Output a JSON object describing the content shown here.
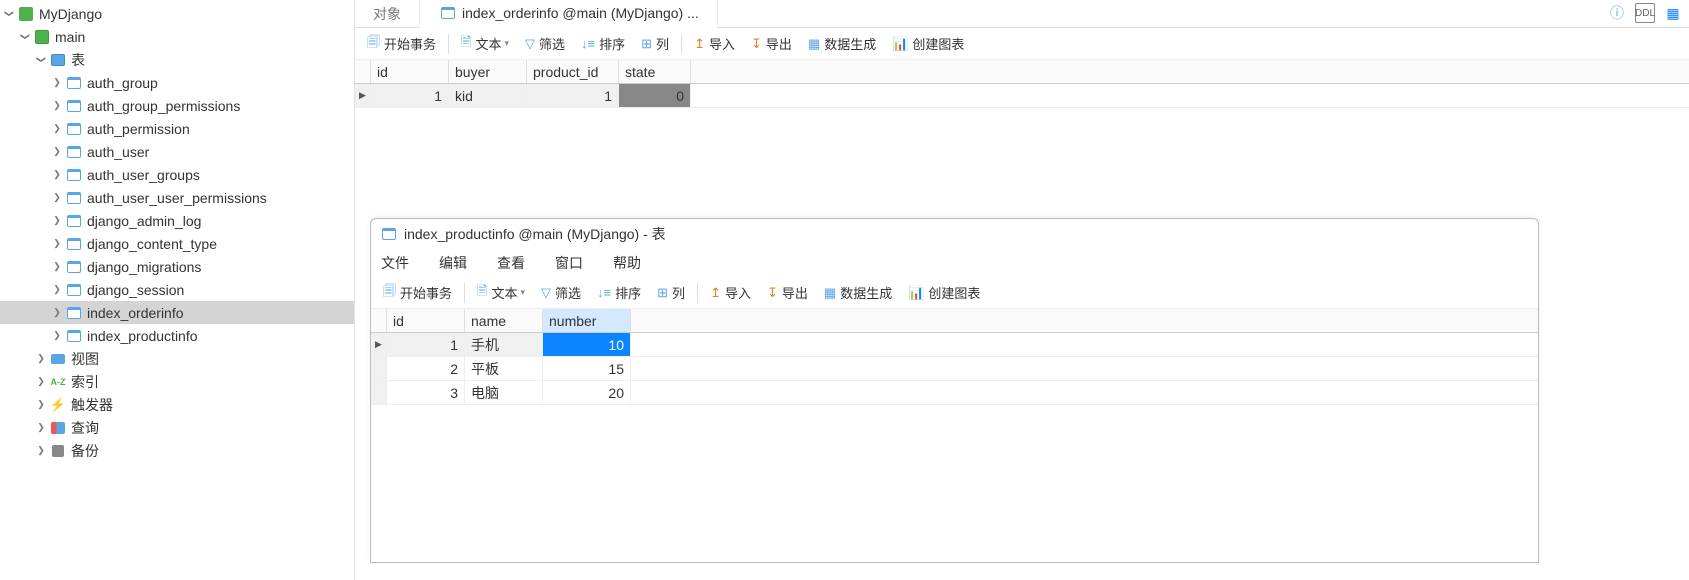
{
  "tree": {
    "root": "MyDjango",
    "schema": "main",
    "tables_label": "表",
    "tables": [
      "auth_group",
      "auth_group_permissions",
      "auth_permission",
      "auth_user",
      "auth_user_groups",
      "auth_user_user_permissions",
      "django_admin_log",
      "django_content_type",
      "django_migrations",
      "django_session",
      "index_orderinfo",
      "index_productinfo"
    ],
    "selected_table": "index_orderinfo",
    "views": "视图",
    "indexes": "索引",
    "triggers": "触发器",
    "queries": "查询",
    "backups": "备份"
  },
  "tabs": {
    "obj": "对象",
    "active": "index_orderinfo @main (MyDjango) ..."
  },
  "toolbar": {
    "begin_tx": "开始事务",
    "text": "文本",
    "filter": "筛选",
    "sort": "排序",
    "columns": "列",
    "import": "导入",
    "export": "导出",
    "datagen": "数据生成",
    "chart": "创建图表"
  },
  "grid1": {
    "cols": [
      "id",
      "buyer",
      "product_id",
      "state"
    ],
    "row": {
      "id": "1",
      "buyer": "kid",
      "product_id": "1",
      "state": "0"
    }
  },
  "popup": {
    "title": "index_productinfo @main (MyDjango) - 表",
    "menu": {
      "file": "文件",
      "edit": "编辑",
      "view": "查看",
      "window": "窗口",
      "help": "帮助"
    },
    "grid": {
      "cols": [
        "id",
        "name",
        "number"
      ],
      "rows": [
        {
          "id": "1",
          "name": "手机",
          "number": "10"
        },
        {
          "id": "2",
          "name": "平板",
          "number": "15"
        },
        {
          "id": "3",
          "name": "电脑",
          "number": "20"
        }
      ]
    }
  }
}
